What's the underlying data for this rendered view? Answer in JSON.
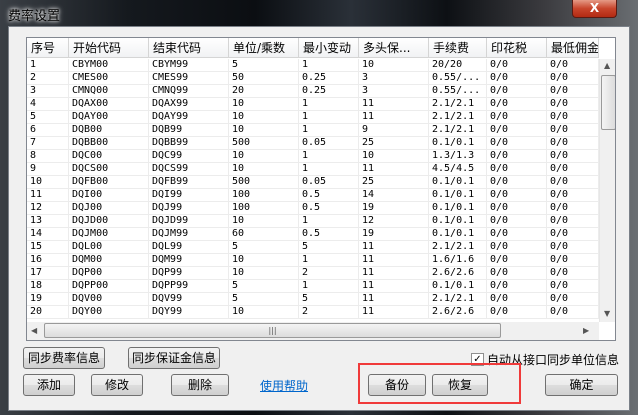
{
  "window": {
    "title": "费率设置",
    "close_label": "X"
  },
  "table": {
    "columns": [
      "序号",
      "开始代码",
      "结束代码",
      "单位/乘数",
      "最小变动",
      "多头保...",
      "手续费",
      "印花税",
      "最低佣金"
    ],
    "rows": [
      [
        "1",
        "CBYM00",
        "CBYM99",
        "5",
        "1",
        "10",
        "20/20",
        "0/0",
        "0/0"
      ],
      [
        "2",
        "CMES00",
        "CMES99",
        "50",
        "0.25",
        "3",
        "0.55/...",
        "0/0",
        "0/0"
      ],
      [
        "3",
        "CMNQ00",
        "CMNQ99",
        "20",
        "0.25",
        "3",
        "0.55/...",
        "0/0",
        "0/0"
      ],
      [
        "4",
        "DQAX00",
        "DQAX99",
        "10",
        "1",
        "11",
        "2.1/2.1",
        "0/0",
        "0/0"
      ],
      [
        "5",
        "DQAY00",
        "DQAY99",
        "10",
        "1",
        "11",
        "2.1/2.1",
        "0/0",
        "0/0"
      ],
      [
        "6",
        "DQB00",
        "DQB99",
        "10",
        "1",
        "9",
        "2.1/2.1",
        "0/0",
        "0/0"
      ],
      [
        "7",
        "DQBB00",
        "DQBB99",
        "500",
        "0.05",
        "25",
        "0.1/0.1",
        "0/0",
        "0/0"
      ],
      [
        "8",
        "DQC00",
        "DQC99",
        "10",
        "1",
        "10",
        "1.3/1.3",
        "0/0",
        "0/0"
      ],
      [
        "9",
        "DQCS00",
        "DQCS99",
        "10",
        "1",
        "11",
        "4.5/4.5",
        "0/0",
        "0/0"
      ],
      [
        "10",
        "DQFB00",
        "DQFB99",
        "500",
        "0.05",
        "25",
        "0.1/0.1",
        "0/0",
        "0/0"
      ],
      [
        "11",
        "DQI00",
        "DQI99",
        "100",
        "0.5",
        "14",
        "0.1/0.1",
        "0/0",
        "0/0"
      ],
      [
        "12",
        "DQJ00",
        "DQJ99",
        "100",
        "0.5",
        "19",
        "0.1/0.1",
        "0/0",
        "0/0"
      ],
      [
        "13",
        "DQJD00",
        "DQJD99",
        "10",
        "1",
        "12",
        "0.1/0.1",
        "0/0",
        "0/0"
      ],
      [
        "14",
        "DQJM00",
        "DQJM99",
        "60",
        "0.5",
        "19",
        "0.1/0.1",
        "0/0",
        "0/0"
      ],
      [
        "15",
        "DQL00",
        "DQL99",
        "5",
        "5",
        "11",
        "2.1/2.1",
        "0/0",
        "0/0"
      ],
      [
        "16",
        "DQM00",
        "DQM99",
        "10",
        "1",
        "11",
        "1.6/1.6",
        "0/0",
        "0/0"
      ],
      [
        "17",
        "DQP00",
        "DQP99",
        "10",
        "2",
        "11",
        "2.6/2.6",
        "0/0",
        "0/0"
      ],
      [
        "18",
        "DQPP00",
        "DQPP99",
        "5",
        "1",
        "11",
        "0.1/0.1",
        "0/0",
        "0/0"
      ],
      [
        "19",
        "DQV00",
        "DQV99",
        "5",
        "5",
        "11",
        "2.1/2.1",
        "0/0",
        "0/0"
      ],
      [
        "20",
        "DQY00",
        "DQY99",
        "10",
        "2",
        "11",
        "2.6/2.6",
        "0/0",
        "0/0"
      ]
    ]
  },
  "buttons": {
    "sync_rate": "同步费率信息",
    "sync_margin": "同步保证金信息",
    "add": "添加",
    "edit": "修改",
    "delete": "删除",
    "help": "使用帮助",
    "backup": "备份",
    "restore": "恢复",
    "ok": "确定"
  },
  "auto_sync": {
    "label": "自动从接口同步单位信息",
    "checked": true,
    "mark": "✓"
  },
  "colors": {
    "highlight": "#f03a3a",
    "link": "#0066cc"
  }
}
